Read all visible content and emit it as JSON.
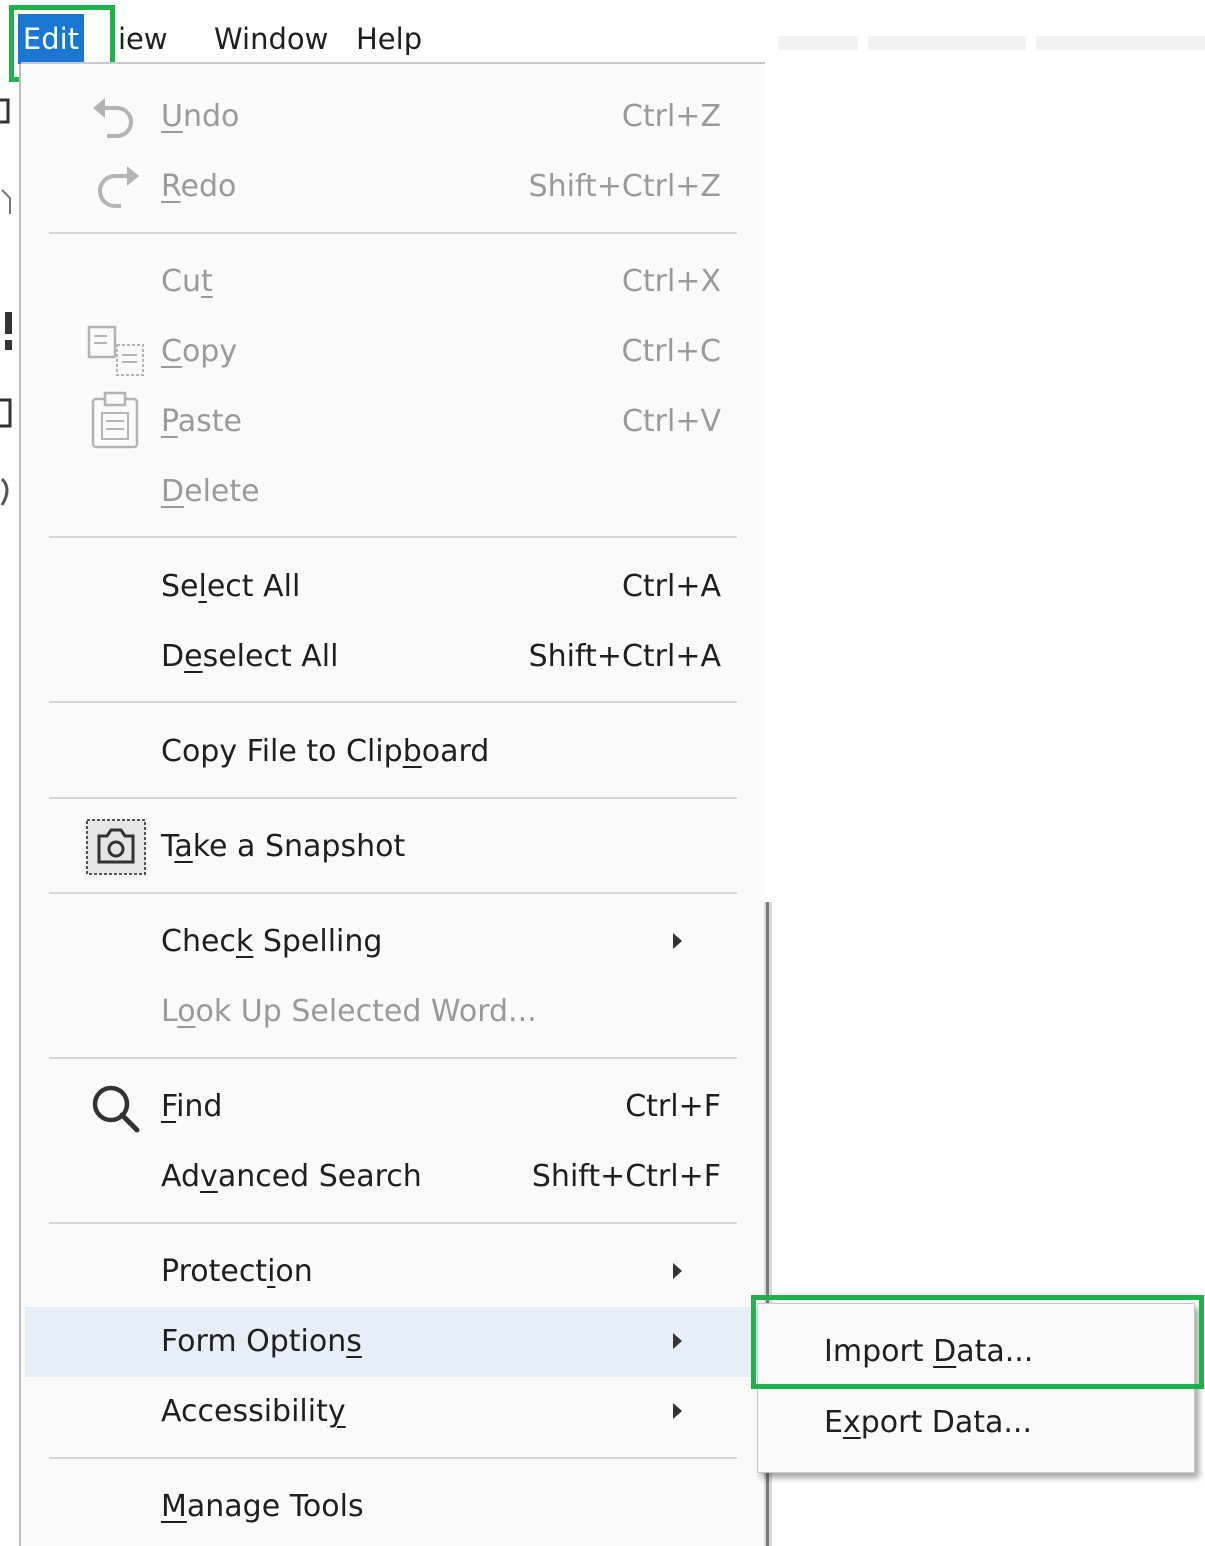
{
  "menubar": {
    "items": [
      "Edit",
      "View",
      "Window",
      "Help"
    ],
    "view_shown": "iew"
  },
  "edit_menu": {
    "items": [
      {
        "label_pre": "",
        "label_u": "U",
        "label_post": "ndo",
        "shortcut": "Ctrl+Z",
        "enabled": false,
        "icon": "undo-icon"
      },
      {
        "label_pre": "",
        "label_u": "R",
        "label_post": "edo",
        "shortcut": "Shift+Ctrl+Z",
        "enabled": false,
        "icon": "redo-icon"
      },
      {
        "label_pre": "Cu",
        "label_u": "t",
        "label_post": "",
        "shortcut": "Ctrl+X",
        "enabled": false
      },
      {
        "label_pre": "",
        "label_u": "C",
        "label_post": "opy",
        "shortcut": "Ctrl+C",
        "enabled": false,
        "icon": "copy-icon"
      },
      {
        "label_pre": "",
        "label_u": "P",
        "label_post": "aste",
        "shortcut": "Ctrl+V",
        "enabled": false,
        "icon": "paste-icon"
      },
      {
        "label_pre": "",
        "label_u": "D",
        "label_post": "elete",
        "shortcut": "",
        "enabled": false
      },
      {
        "label_pre": "Se",
        "label_u": "l",
        "label_post": "ect All",
        "shortcut": "Ctrl+A",
        "enabled": true
      },
      {
        "label_pre": "D",
        "label_u": "e",
        "label_post": "select All",
        "shortcut": "Shift+Ctrl+A",
        "enabled": true
      },
      {
        "label_pre": "Copy File to Clip",
        "label_u": "b",
        "label_post": "oard",
        "shortcut": "",
        "enabled": true
      },
      {
        "label_pre": "T",
        "label_u": "a",
        "label_post": "ke a Snapshot",
        "shortcut": "",
        "enabled": true,
        "icon": "camera-icon"
      },
      {
        "label_pre": "Chec",
        "label_u": "k",
        "label_post": " Spelling",
        "shortcut": "",
        "enabled": true,
        "submenu": true
      },
      {
        "label_pre": "L",
        "label_u": "o",
        "label_post": "ok Up Selected Word...",
        "shortcut": "",
        "enabled": false
      },
      {
        "label_pre": "",
        "label_u": "F",
        "label_post": "ind",
        "shortcut": "Ctrl+F",
        "enabled": true,
        "icon": "search-icon"
      },
      {
        "label_pre": "Ad",
        "label_u": "v",
        "label_post": "anced Search",
        "shortcut": "Shift+Ctrl+F",
        "enabled": true
      },
      {
        "label_pre": "Protect",
        "label_u": "i",
        "label_post": "on",
        "shortcut": "",
        "enabled": true,
        "submenu": true
      },
      {
        "label_pre": "Form Option",
        "label_u": "s",
        "label_post": "",
        "shortcut": "",
        "enabled": true,
        "submenu": true,
        "highlighted": true
      },
      {
        "label_pre": "Accessibilit",
        "label_u": "y",
        "label_post": "",
        "shortcut": "",
        "enabled": true,
        "submenu": true
      },
      {
        "label_pre": "",
        "label_u": "M",
        "label_post": "anage Tools",
        "shortcut": "",
        "enabled": true
      }
    ]
  },
  "form_options_submenu": {
    "items": [
      {
        "label_pre": "Import ",
        "label_u": "D",
        "label_post": "ata..."
      },
      {
        "label_pre": "E",
        "label_u": "x",
        "label_post": "port Data..."
      }
    ]
  },
  "colors": {
    "highlight_box": "#20b14a",
    "active_menu": "#1976d2",
    "hover_row": "#e6eef8"
  }
}
